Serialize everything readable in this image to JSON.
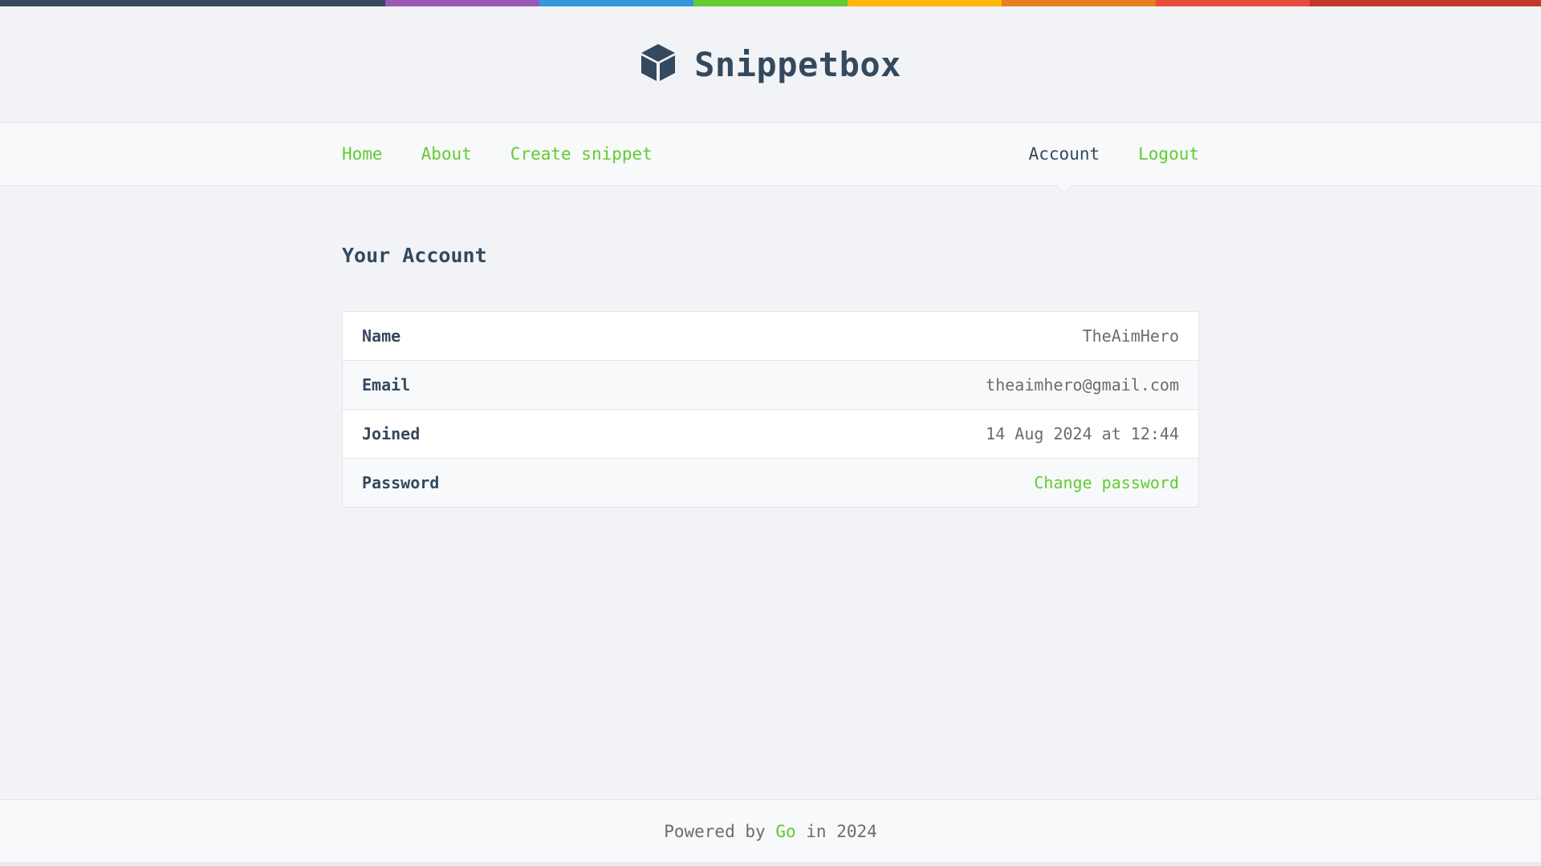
{
  "colors": {
    "accent": "#62cb31",
    "text_dark": "#34495e",
    "text_muted": "#6a6c6f",
    "background": "#f1f3f6"
  },
  "header": {
    "logo_icon": "cube-icon",
    "title": "Snippetbox"
  },
  "nav": {
    "left": [
      {
        "label": "Home"
      },
      {
        "label": "About"
      },
      {
        "label": "Create snippet"
      }
    ],
    "right": [
      {
        "label": "Account",
        "active": true
      },
      {
        "label": "Logout"
      }
    ]
  },
  "main": {
    "title": "Your Account",
    "rows": [
      {
        "label": "Name",
        "value": "TheAimHero"
      },
      {
        "label": "Email",
        "value": "theaimhero@gmail.com"
      },
      {
        "label": "Joined",
        "value": "14 Aug 2024 at 12:44"
      },
      {
        "label": "Password",
        "value": "Change password"
      }
    ]
  },
  "footer": {
    "prefix": "Powered by",
    "link": "Go",
    "suffix": "in 2024"
  }
}
